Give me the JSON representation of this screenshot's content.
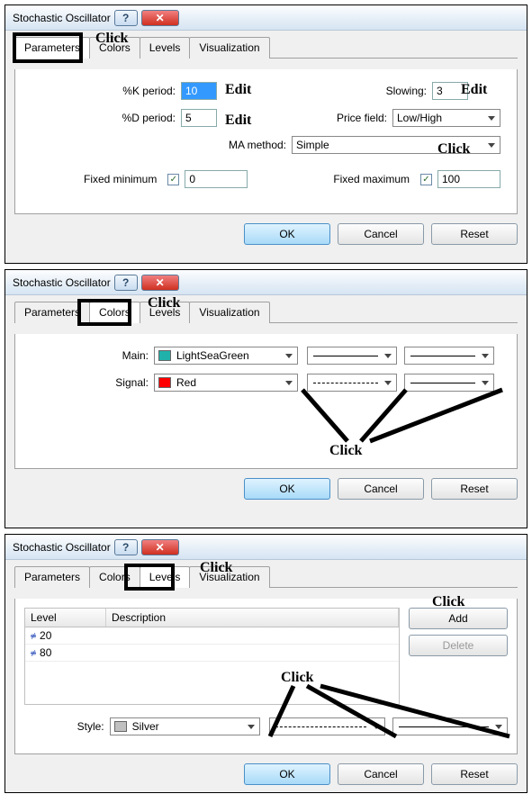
{
  "dialog_title": "Stochastic Oscillator",
  "tabs": {
    "parameters": "Parameters",
    "colors": "Colors",
    "levels": "Levels",
    "visualization": "Visualization"
  },
  "buttons": {
    "ok": "OK",
    "cancel": "Cancel",
    "reset": "Reset",
    "add": "Add",
    "delete": "Delete",
    "help": "?",
    "close": "✕"
  },
  "annotations": {
    "click": "Click",
    "edit": "Edit"
  },
  "params": {
    "k_label": "%K period:",
    "k_value": "10",
    "slowing_label": "Slowing:",
    "slowing_value": "3",
    "d_label": "%D period:",
    "d_value": "5",
    "price_label": "Price field:",
    "price_value": "Low/High",
    "ma_label": "MA method:",
    "ma_value": "Simple",
    "fixmin_label": "Fixed minimum",
    "fixmin_value": "0",
    "fixmax_label": "Fixed maximum",
    "fixmax_value": "100"
  },
  "colors": {
    "main_label": "Main:",
    "main_value": "LightSeaGreen",
    "main_hex": "#20B2AA",
    "signal_label": "Signal:",
    "signal_value": "Red",
    "signal_hex": "#ff0000"
  },
  "levels_panel": {
    "col_level": "Level",
    "col_desc": "Description",
    "rows": [
      {
        "value": "20"
      },
      {
        "value": "80"
      }
    ],
    "style_label": "Style:",
    "style_value": "Silver",
    "style_hex": "#C0C0C0"
  }
}
